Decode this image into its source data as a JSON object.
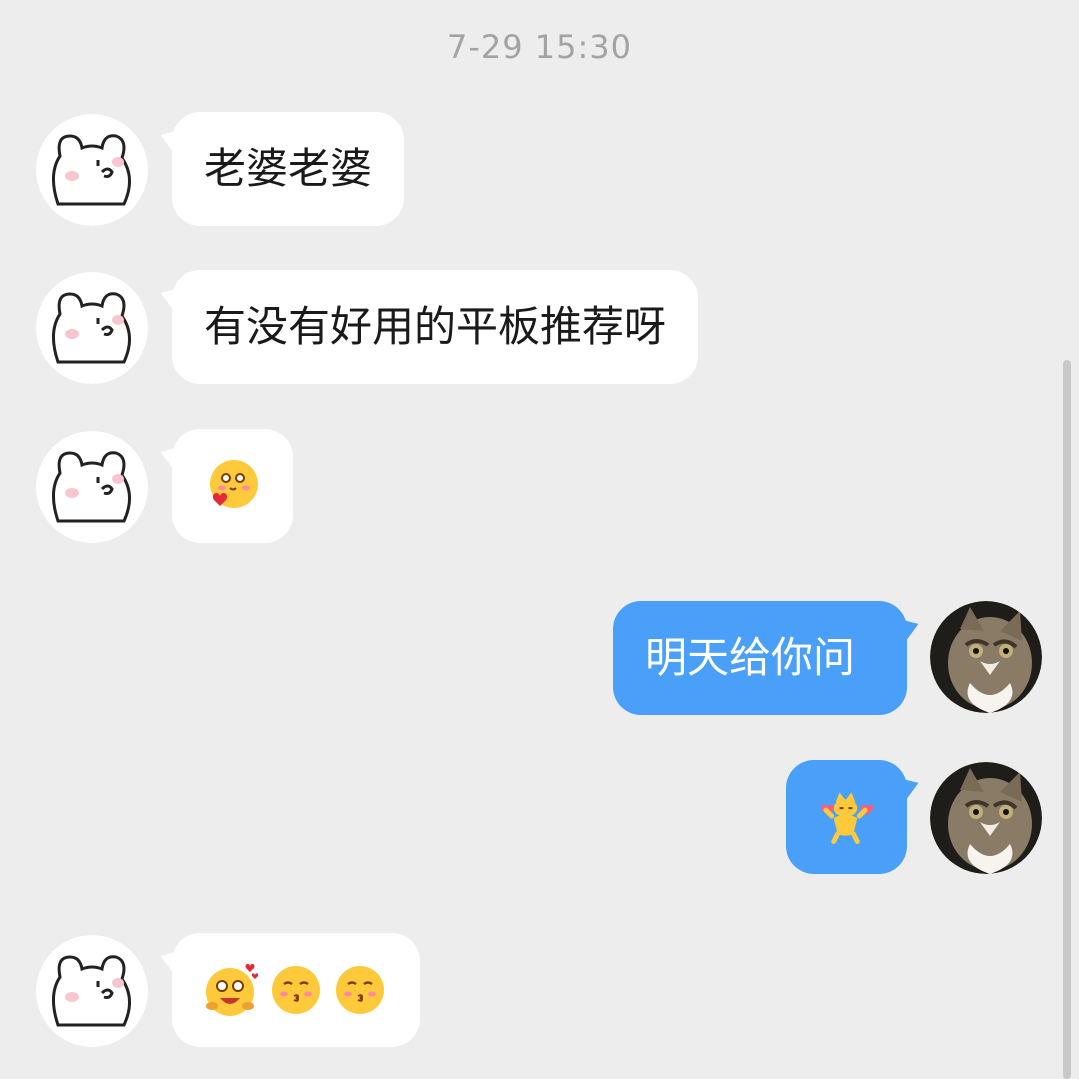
{
  "timestamp": "7-29 15:30",
  "messages": [
    {
      "side": "in",
      "text": "老婆老婆"
    },
    {
      "side": "in",
      "text": "有没有好用的平板推荐呀"
    },
    {
      "side": "in",
      "sticker": "shy-heart-emoji"
    },
    {
      "side": "out",
      "text": "明天给你问"
    },
    {
      "side": "out",
      "sticker": "dancing-cat-hearts-emoji"
    },
    {
      "side": "in",
      "stickers": [
        "excited-hearts-emoji",
        "kiss-emoji",
        "kiss-emoji"
      ]
    }
  ],
  "colors": {
    "background": "#ededed",
    "incoming_bubble": "#ffffff",
    "outgoing_bubble": "#4aa0f8",
    "timestamp_text": "#a3a3a3"
  }
}
